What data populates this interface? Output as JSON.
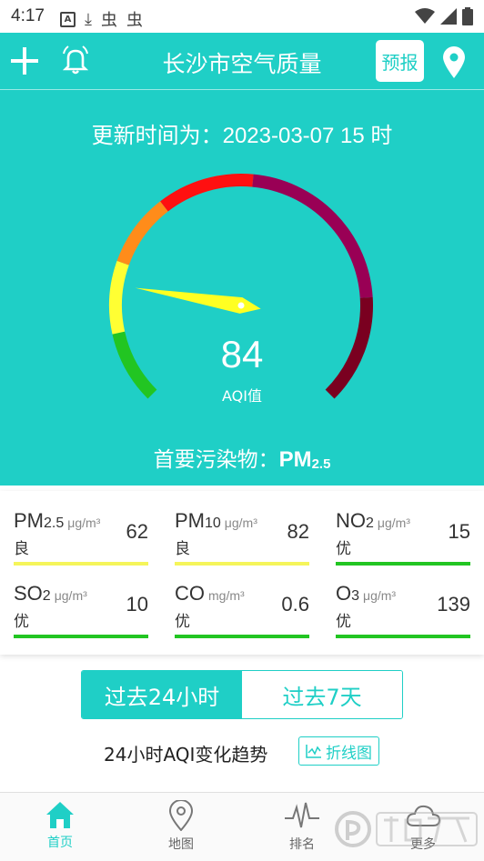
{
  "status_bar": {
    "time": "4:17"
  },
  "header": {
    "title": "长沙市空气质量",
    "forecast_label": "预报"
  },
  "update_time": "更新时间为：2023-03-07 15 时",
  "gauge": {
    "aqi_value": "84",
    "aqi_label": "AQI值",
    "max_aqi": 500,
    "colors": [
      "#22c522",
      "#ffff33",
      "#ff8c1a",
      "#ff1010",
      "#990055",
      "#7a0020"
    ]
  },
  "primary_pollutant": {
    "label": "首要污染物：",
    "name": "PM",
    "sub": "2.5"
  },
  "pollutants": [
    {
      "name": "PM",
      "sub": "2.5",
      "unit": "μg/m³",
      "level": "良",
      "value": "62",
      "color": "#f5f55a"
    },
    {
      "name": "PM",
      "sub": "10",
      "unit": "μg/m³",
      "level": "良",
      "value": "82",
      "color": "#f5f55a"
    },
    {
      "name": "NO",
      "sub": "2",
      "unit": "μg/m³",
      "level": "优",
      "value": "15",
      "color": "#22c522"
    },
    {
      "name": "SO",
      "sub": "2",
      "unit": "μg/m³",
      "level": "优",
      "value": "10",
      "color": "#22c522"
    },
    {
      "name": "CO",
      "sub": "",
      "unit": "mg/m³",
      "level": "优",
      "value": "0.6",
      "color": "#22c522"
    },
    {
      "name": "O",
      "sub": "3",
      "unit": "μg/m³",
      "level": "优",
      "value": "139",
      "color": "#22c522"
    }
  ],
  "toggle": {
    "left": "过去24小时",
    "right": "过去7天"
  },
  "trend": {
    "title": "24小时AQI变化趋势",
    "button": "折线图"
  },
  "bottom_nav": [
    {
      "label": "首页",
      "icon": "home-icon",
      "active": true
    },
    {
      "label": "地图",
      "icon": "map-pin-icon",
      "active": false
    },
    {
      "label": "排名",
      "icon": "pulse-icon",
      "active": false
    },
    {
      "label": "更多",
      "icon": "cloud-icon",
      "active": false
    }
  ],
  "accent_color": "#1fcfc6"
}
